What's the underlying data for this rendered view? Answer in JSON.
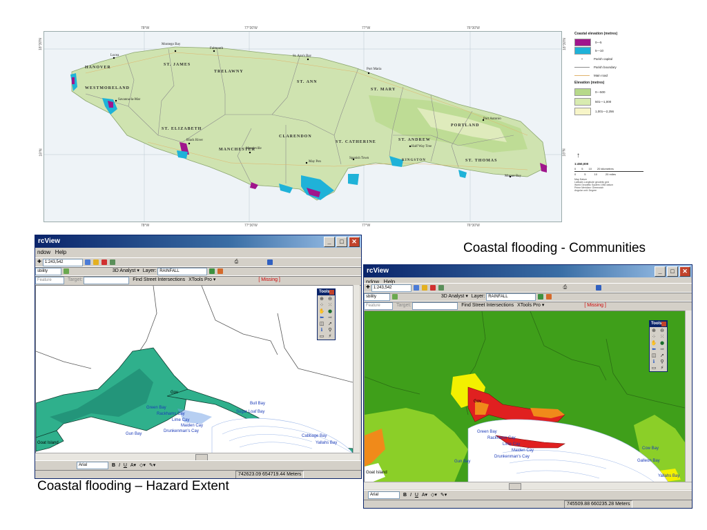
{
  "top_map": {
    "graticule_top": [
      "78°W",
      "77°30'W",
      "77°W",
      "76°30'W"
    ],
    "graticule_bottom": [
      "78°W",
      "77°30'W",
      "77°W",
      "76°30'W"
    ],
    "graticule_side": [
      "18°30'N",
      "18°N"
    ],
    "parishes": [
      "HANOVER",
      "ST. JAMES",
      "TRELAWNY",
      "ST. ANN",
      "ST. MARY",
      "WESTMORELAND",
      "ST. ELIZABETH",
      "MANCHESTER",
      "CLARENDON",
      "ST. CATHERINE",
      "ST. ANDREW",
      "PORTLAND",
      "ST. THOMAS",
      "KINGSTON"
    ],
    "towns": [
      "Lucea",
      "Montego Bay",
      "Falmouth",
      "St. Ann's Bay",
      "Port Maria",
      "Savanna-la-Mar",
      "Black River",
      "Mandeville",
      "May Pen",
      "Spanish Town",
      "Half Way Tree",
      "Port Antonio",
      "Morant Bay"
    ],
    "legend": {
      "title_elev": "Coastal elevation (metres)",
      "elev_items": [
        {
          "label": "0—5",
          "color": "#a0158c"
        },
        {
          "label": "5—10",
          "color": "#1fb2d8"
        }
      ],
      "symbols": [
        "Parish capital",
        "Parish boundary",
        "Main road"
      ],
      "title_land": "Elevation (metres)",
      "land_items": [
        {
          "label": "0—500",
          "color": "#b7d98a"
        },
        {
          "label": "501—1,000",
          "color": "#d8ebb0"
        },
        {
          "label": "1,001—2,256",
          "color": "#f7f5c8"
        }
      ],
      "scale": "1:450,000",
      "km_ticks": [
        "0",
        "5",
        "10",
        "20 kilometres"
      ],
      "mi_ticks": [
        "0",
        "5",
        "10",
        "20 miles"
      ],
      "notes": [
        "Map Datum",
        "Latitude-Longitude geodetic grid",
        "World Geodetic System 1984 datum",
        "Prime Meridian: Greenwich",
        "Angular unit: Degree"
      ]
    }
  },
  "captions": {
    "communities": "Coastal flooding - Communities",
    "hazard": "Coastal flooding – Hazard Extent"
  },
  "left_window": {
    "title": "rcView",
    "menu": [
      "ndow",
      "Help"
    ],
    "scale": "1:243,542",
    "layer_label": "Layer:",
    "layer_value": "RAINFALL",
    "analyst": "3D Analyst ▾",
    "visibility": "sbility",
    "feature": "Feature",
    "target": "Target:",
    "street": "Find Street Intersections",
    "xtools": "XTools Pro ▾",
    "missing": "[ Missing ]",
    "font": "Arial",
    "coords": "742623.09  654719.44 Meters",
    "tools_title": "Tools",
    "places": [
      "Gov",
      "Rackhams Cay",
      "Lime Cay",
      "Maiden Cay",
      "Drunkenman's Cay",
      "Green Bay",
      "Sugar Loaf Bay",
      "Bull Bay",
      "Goat Island",
      "Gun Bay",
      "Cabbage Bay",
      "Yallahs Bay"
    ]
  },
  "right_window": {
    "title": "rcView",
    "menu": [
      "ndow",
      "Help"
    ],
    "scale": "1:243,542",
    "layer_label": "Layer:",
    "layer_value": "RAINFALL",
    "analyst": "3D Analyst ▾",
    "visibility": "sbility",
    "feature": "Feature",
    "target": "Target:",
    "street": "Find Street Intersections",
    "xtools": "XTools Pro ▾",
    "missing": "[ Missing ]",
    "font": "Arial",
    "coords": "745509.88  660235.28 Meters",
    "tools_title": "Tools",
    "places": [
      "Gov",
      "Rackhams Cay",
      "Lime Cay",
      "Maiden Cay",
      "Drunkenman's Cay",
      "Green Bay",
      "Gun Bay",
      "Goat Island",
      "Galleon Bay",
      "Yallahs Bay",
      "Cow Bay"
    ]
  },
  "colors": {
    "land": "#cfe3b0",
    "flood_0_5": "#a0158c",
    "flood_5_10": "#1fb2d8",
    "hazard_teal": "#2fb08c",
    "community_green": "#3f9f1a",
    "community_red": "#e02020",
    "community_yellow": "#f3f000",
    "community_orange": "#f08a1a"
  }
}
